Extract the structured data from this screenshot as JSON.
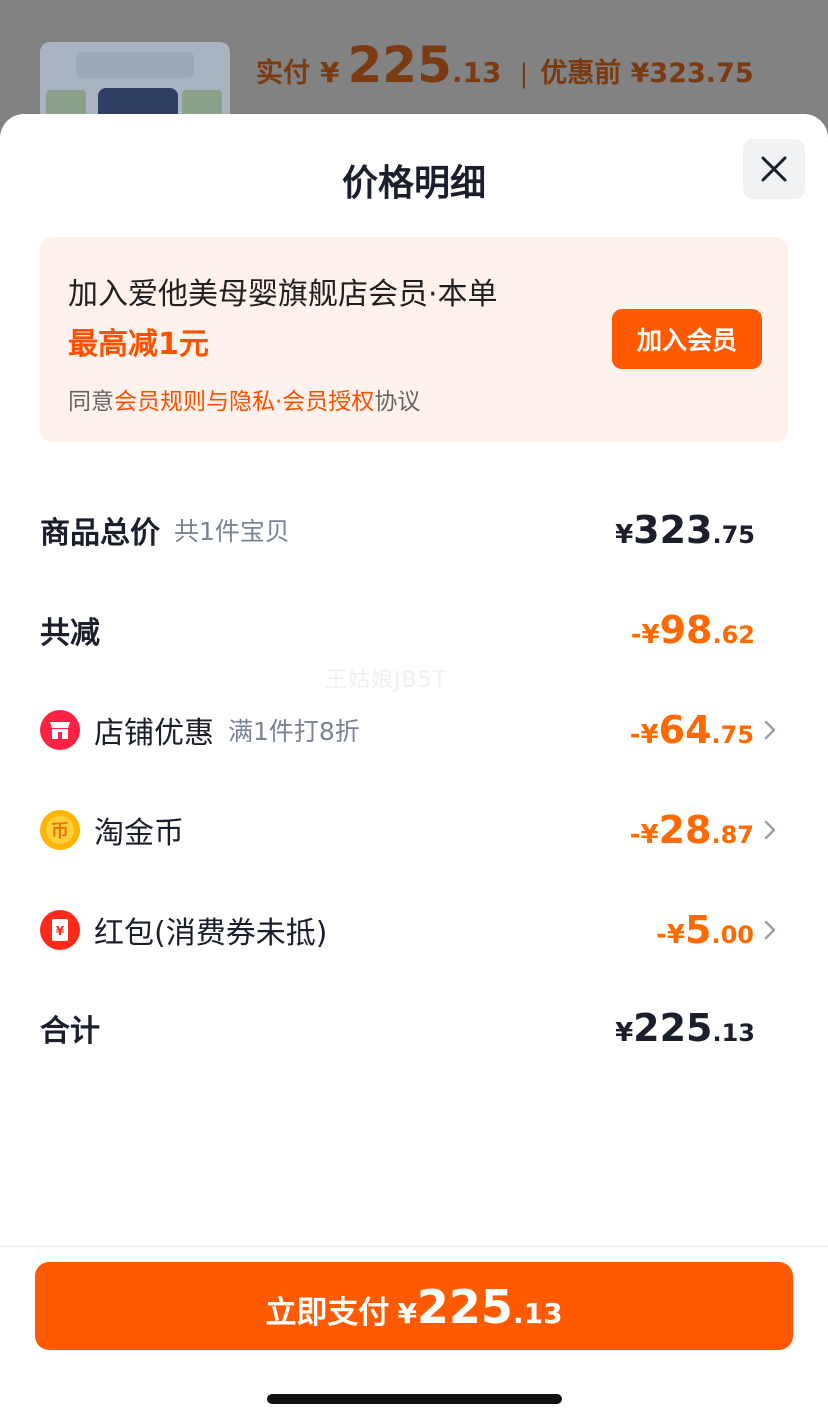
{
  "backdrop": {
    "paid_label": "实付",
    "yen": "¥",
    "paid_int": "225",
    "paid_dec": ".13",
    "separator": "|",
    "before_label": "优惠前 ¥323.75"
  },
  "sheet": {
    "title": "价格明细"
  },
  "member": {
    "title": "加入爱他美母婴旗舰店会员·本单",
    "highlight": "最高减1元",
    "agree_prefix": "同意",
    "agree_link": "会员规则与隐私·会员授权",
    "agree_suffix": "协议",
    "join_label": "加入会员"
  },
  "rows": {
    "subtotal": {
      "label": "商品总价",
      "note": "共1件宝贝",
      "yen": "¥",
      "int": "323",
      "dec": ".75"
    },
    "discount_total": {
      "label": "共减",
      "yen": "-¥",
      "int": "98",
      "dec": ".62"
    },
    "shop_discount": {
      "label": "店铺优惠",
      "note": "满1件打8折",
      "yen": "-¥",
      "int": "64",
      "dec": ".75",
      "icon": "shop-icon"
    },
    "coins": {
      "label": "淘金币",
      "yen": "-¥",
      "int": "28",
      "dec": ".87",
      "icon": "coin-icon"
    },
    "red_packet": {
      "label": "红包(消费券未抵)",
      "yen": "-¥",
      "int": "5",
      "dec": ".00",
      "icon": "red-packet-icon"
    },
    "total": {
      "label": "合计",
      "yen": "¥",
      "int": "225",
      "dec": ".13"
    }
  },
  "watermark": "王姑娘JB5T",
  "pay": {
    "label": "立即支付",
    "yen": "¥",
    "int": "225",
    "dec": ".13"
  },
  "colors": {
    "accent": "#ff5a00",
    "price_orange": "#ff6a00",
    "text_dark": "#1b1f2b",
    "banner_bg": "#fff1eb"
  }
}
